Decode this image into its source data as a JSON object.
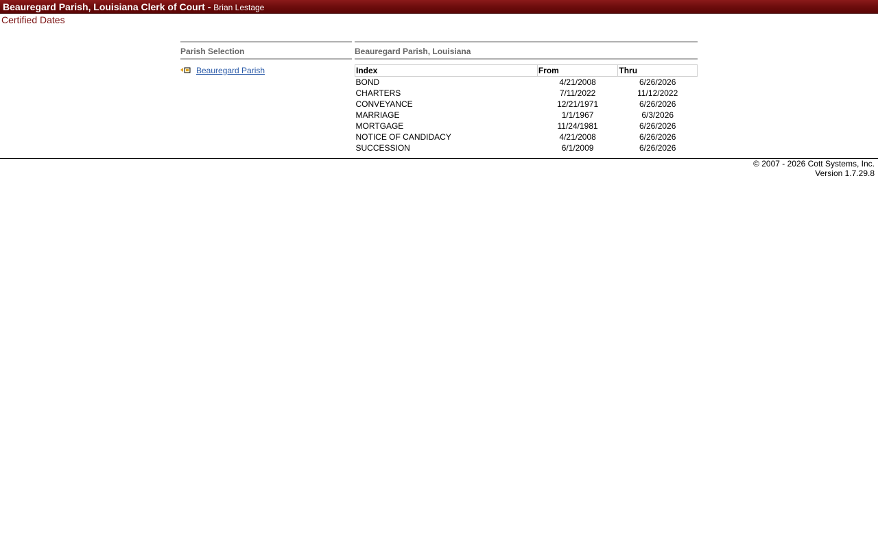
{
  "header": {
    "title": "Beauregard Parish, Louisiana Clerk of Court - ",
    "user": "Brian Lestage"
  },
  "page": {
    "subtitle": "Certified Dates"
  },
  "left_panel": {
    "heading": "Parish Selection",
    "parish_link": "Beauregard Parish",
    "icon": "arrow-select-icon"
  },
  "right_panel": {
    "heading": "Beauregard Parish, Louisiana",
    "table": {
      "columns": [
        "Index",
        "From",
        "Thru"
      ],
      "rows": [
        {
          "index": "BOND",
          "from": "4/21/2008",
          "thru": "6/26/2026"
        },
        {
          "index": "CHARTERS",
          "from": "7/11/2022",
          "thru": "11/12/2022"
        },
        {
          "index": "CONVEYANCE",
          "from": "12/21/1971",
          "thru": "6/26/2026"
        },
        {
          "index": "MARRIAGE",
          "from": "1/1/1967",
          "thru": "6/3/2026"
        },
        {
          "index": "MORTGAGE",
          "from": "11/24/1981",
          "thru": "6/26/2026"
        },
        {
          "index": "NOTICE OF CANDIDACY",
          "from": "4/21/2008",
          "thru": "6/26/2026"
        },
        {
          "index": "SUCCESSION",
          "from": "6/1/2009",
          "thru": "6/26/2026"
        }
      ]
    }
  },
  "footer": {
    "copyright": "© 2007 - 2026 Cott Systems, Inc.",
    "version": "Version 1.7.29.8"
  },
  "colors": {
    "header_bg": "#6e0d0d",
    "subtitle": "#7a1010",
    "link": "#2a5aa8"
  }
}
